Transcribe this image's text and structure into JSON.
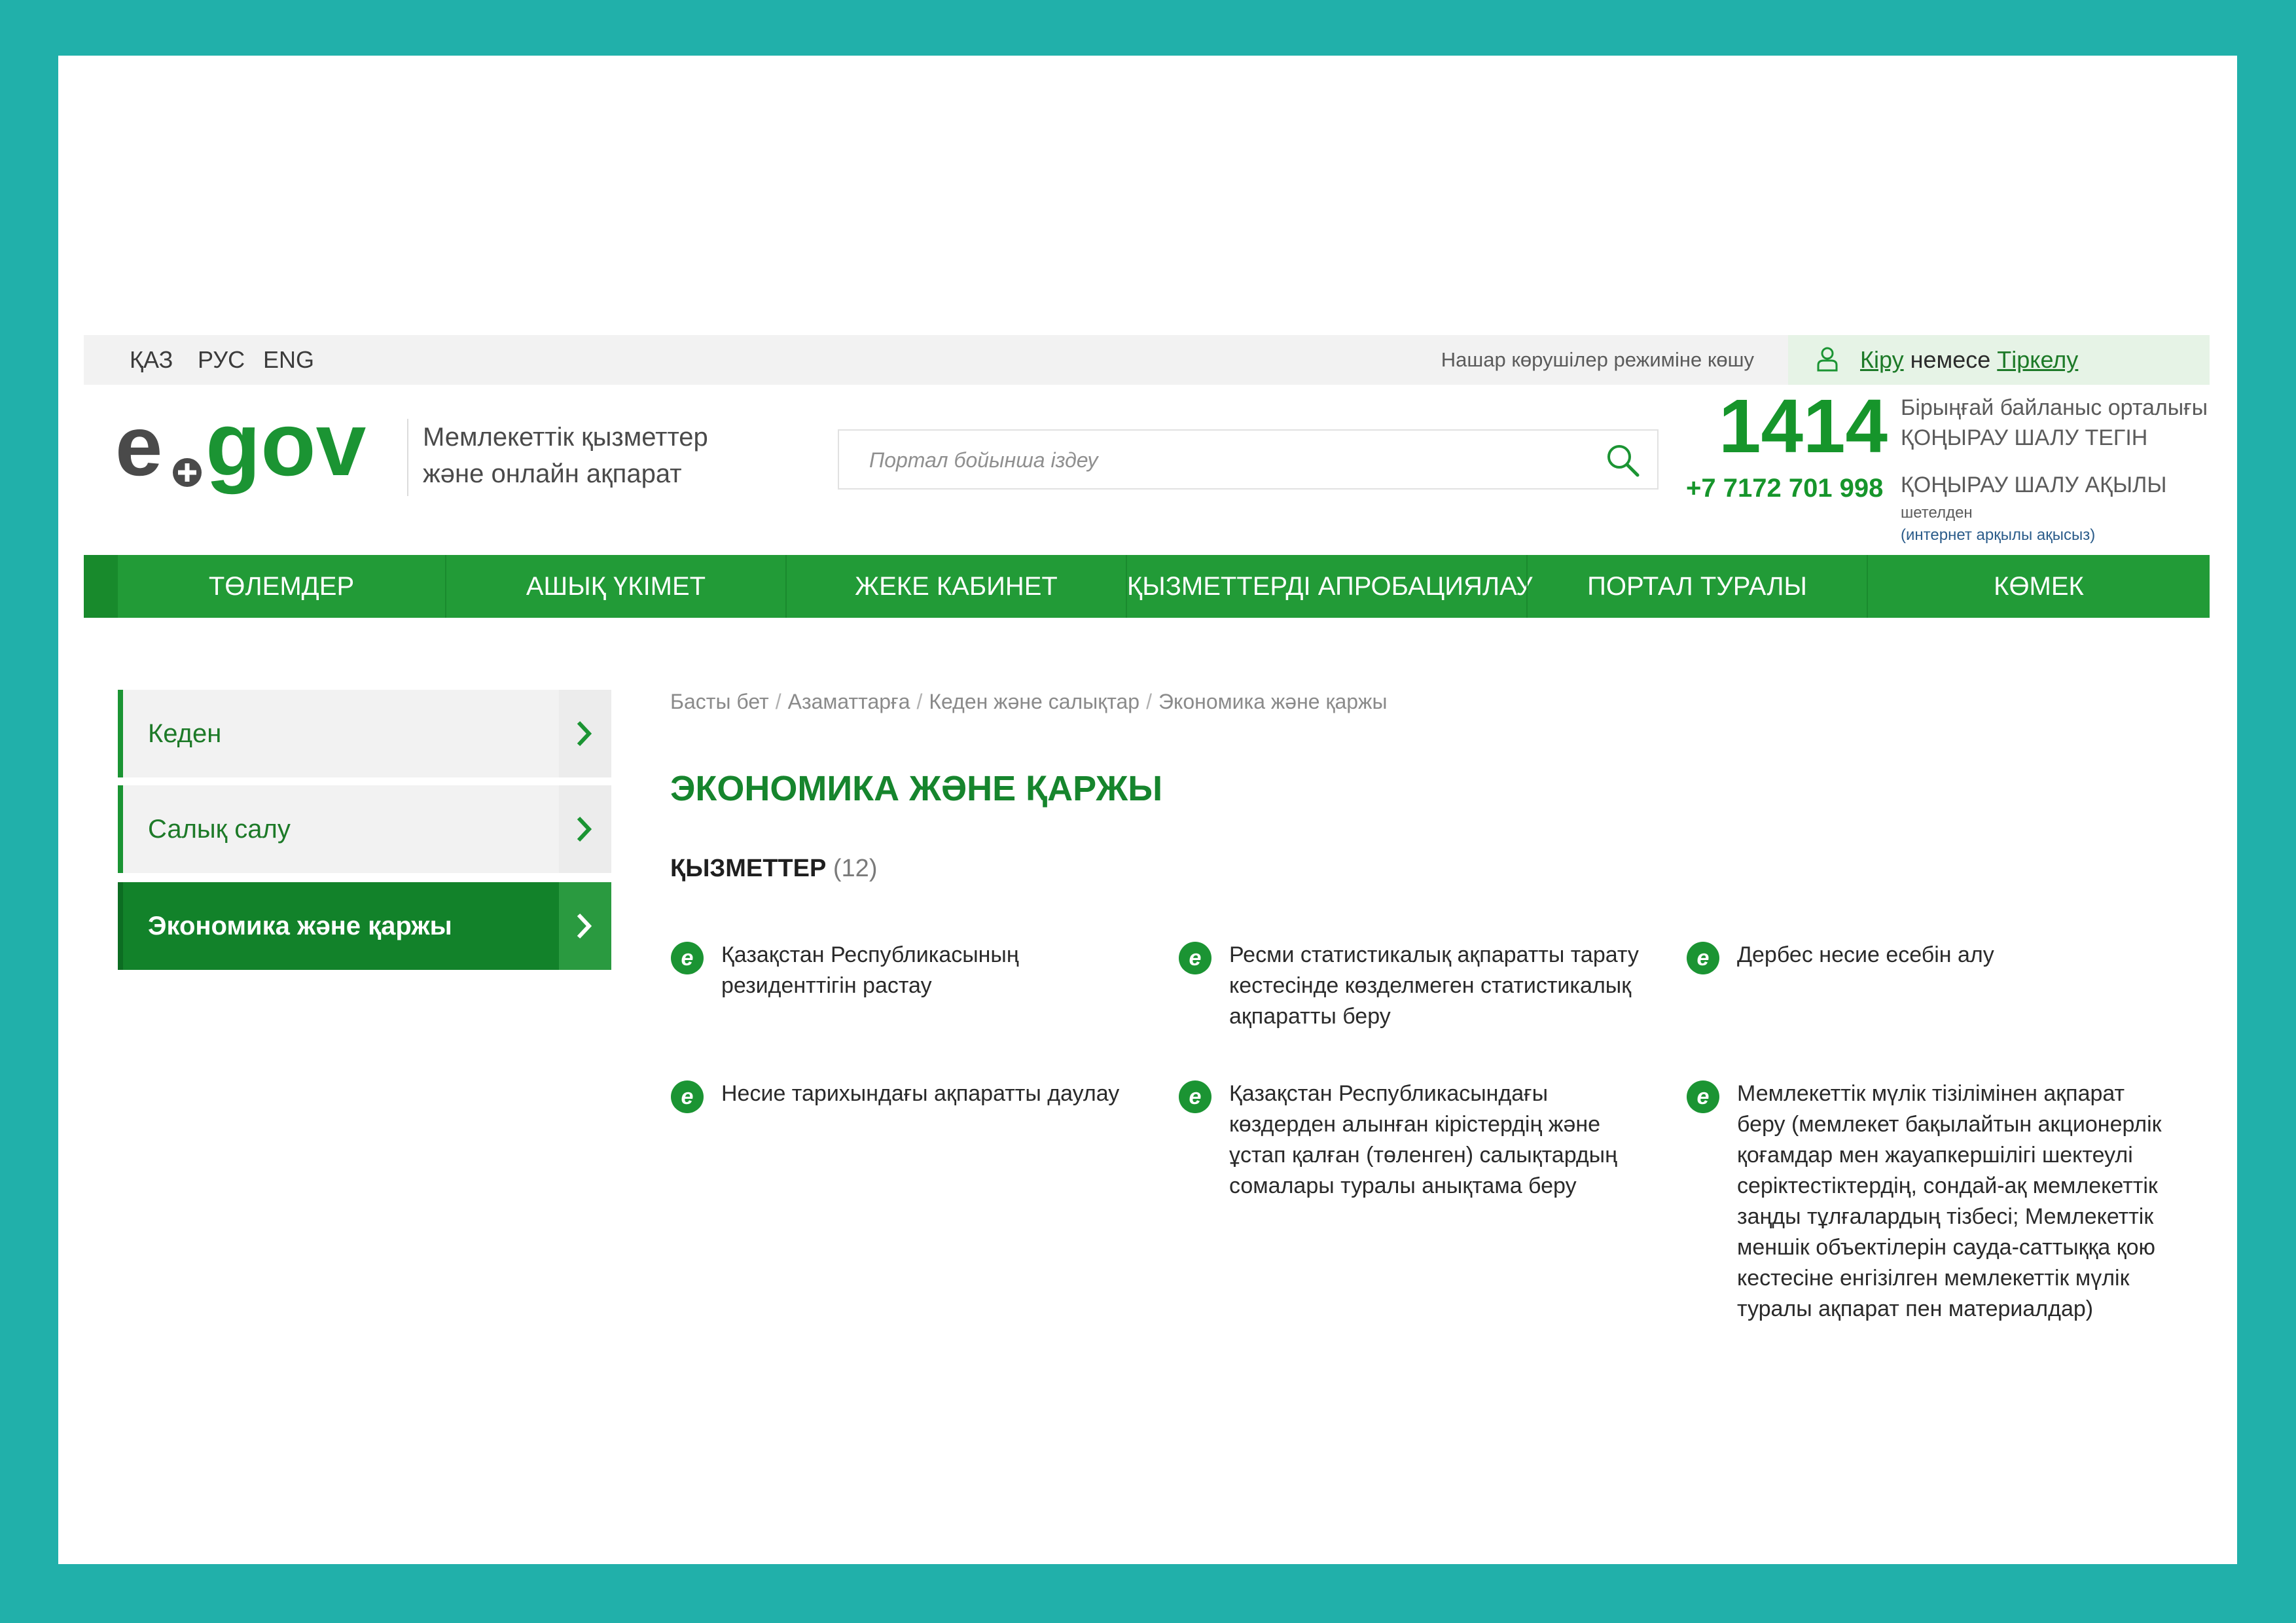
{
  "language_switcher": [
    "ҚАЗ",
    "РУС",
    "ENG"
  ],
  "topbar": {
    "accessibility_link": "Нашар көрушілер режиміне көшу",
    "login_label": "Кіру",
    "login_separator": " немесе ",
    "register_label": "Тіркелу"
  },
  "header": {
    "tagline_line1": "Мемлекеттік қызметтер",
    "tagline_line2": "және онлайн ақпарат",
    "search_placeholder": "Портал бойынша іздеу",
    "contacts": {
      "short_number": "1414",
      "paid_number": "+7 7172 701 998",
      "center_name": "Бірыңғай байланыс орталығы",
      "free_call": "ҚОҢЫРАУ ШАЛУ ТЕГІН",
      "paid_call": "ҚОҢЫРАУ ШАЛУ АҚЫЛЫ",
      "abroad": "шетелден",
      "internet_note": "(интернет арқылы ақысыз)"
    }
  },
  "nav": [
    "ТӨЛЕМДЕР",
    "АШЫҚ ҮКІМЕТ",
    "ЖЕКЕ КАБИНЕТ",
    "ҚЫЗМЕТТЕРДІ АПРОБАЦИЯЛАУ",
    "ПОРТАЛ ТУРАЛЫ",
    "КӨМЕК"
  ],
  "sidebar": [
    {
      "label": "Кеден",
      "active": false
    },
    {
      "label": "Салық салу",
      "active": false
    },
    {
      "label": "Экономика және қаржы",
      "active": true
    }
  ],
  "breadcrumb": [
    "Басты бет",
    "Азаматтарға",
    "Кеден және салықтар",
    "Экономика және қаржы"
  ],
  "page_title": "ЭКОНОМИКА ЖӘНЕ ҚАРЖЫ",
  "services_heading": "ҚЫЗМЕТТЕР",
  "services_count": "(12)",
  "services": [
    [
      "Қазақстан Республикасының",
      "резиденттігін растау"
    ],
    [
      "Ресми статистикалық ақпаратты тарату",
      "кестесінде көзделмеген статистикалық",
      "ақпаратты беру"
    ],
    [
      "Дербес несие есебін алу"
    ],
    [
      "Несие тарихындағы ақпаратты даулау"
    ],
    [
      "Қазақстан Республикасындағы",
      "көздерден алынған кірістердің және",
      "ұстап қалған (төленген) салықтардың",
      "сомалары туралы анықтама беру"
    ],
    [
      "Мемлекеттік мүлік тізілімінен ақпарат",
      "беру (мемлекет бақылайтын акционерлік",
      "қоғамдар мен жауапкершілігі шектеулі",
      "серіктестіктердің, сондай-ақ мемлекеттік",
      "заңды тұлғалардың тізбесі; Мемлекеттік",
      "меншік объектілерін сауда-саттыққа қою",
      "кестесіне енгізілген мемлекеттік мүлік",
      "туралы ақпарат пен материалдар)"
    ]
  ],
  "colors": {
    "brand_green": "#229b37",
    "title_green": "#16852d",
    "frame_background": "#21b0aa"
  },
  "icons": {
    "search": "search-icon",
    "user": "user-icon",
    "chevron": "chevron-right-icon",
    "service": "e-service-icon"
  }
}
